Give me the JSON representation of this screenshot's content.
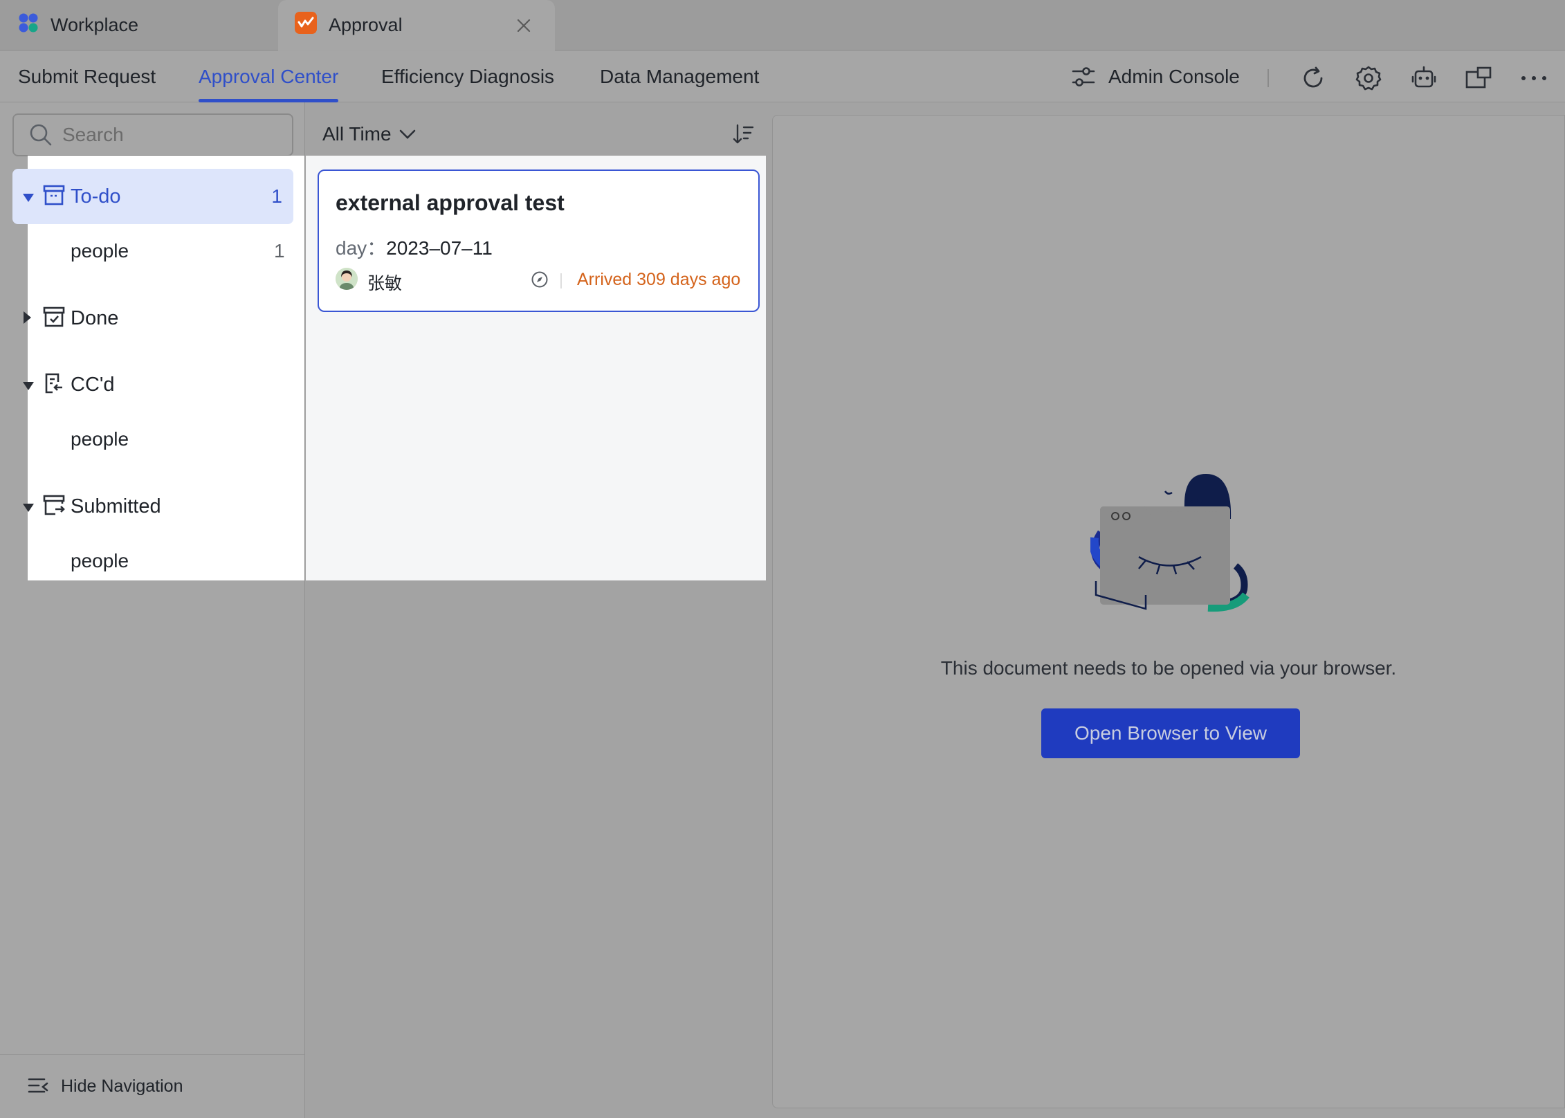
{
  "tabs": [
    {
      "label": "Workplace",
      "icon": "workplace-icon"
    },
    {
      "label": "Approval",
      "icon": "approval-app-icon",
      "active": true
    }
  ],
  "nav": {
    "tabs": [
      "Submit Request",
      "Approval Center",
      "Efficiency Diagnosis",
      "Data Management"
    ],
    "active": "Approval Center",
    "admin_console": "Admin Console"
  },
  "sidebar": {
    "search_placeholder": "Search",
    "groups": [
      {
        "label": "To-do",
        "count": "1",
        "expanded": true,
        "selected": true,
        "children": [
          {
            "label": "people",
            "count": "1"
          }
        ]
      },
      {
        "label": "Done",
        "expanded": false
      },
      {
        "label": "CC'd",
        "expanded": true,
        "children": [
          {
            "label": "people"
          }
        ]
      },
      {
        "label": "Submitted",
        "expanded": true,
        "children": [
          {
            "label": "people"
          }
        ]
      }
    ],
    "hide_navigation": "Hide Navigation"
  },
  "list": {
    "filter": "All Time",
    "items": [
      {
        "title": "external approval test",
        "field_key": "day：",
        "field_value": "2023–07–11",
        "user": "张敏",
        "arrived": "Arrived 309 days ago"
      }
    ]
  },
  "detail": {
    "message": "This document needs to be opened via your browser.",
    "button": "Open Browser to View"
  },
  "colors": {
    "accent": "#2f4fc9",
    "primary_button": "#1f3bbf",
    "arrived_text": "#d4631b",
    "selected_bg": "#dde5fb"
  }
}
